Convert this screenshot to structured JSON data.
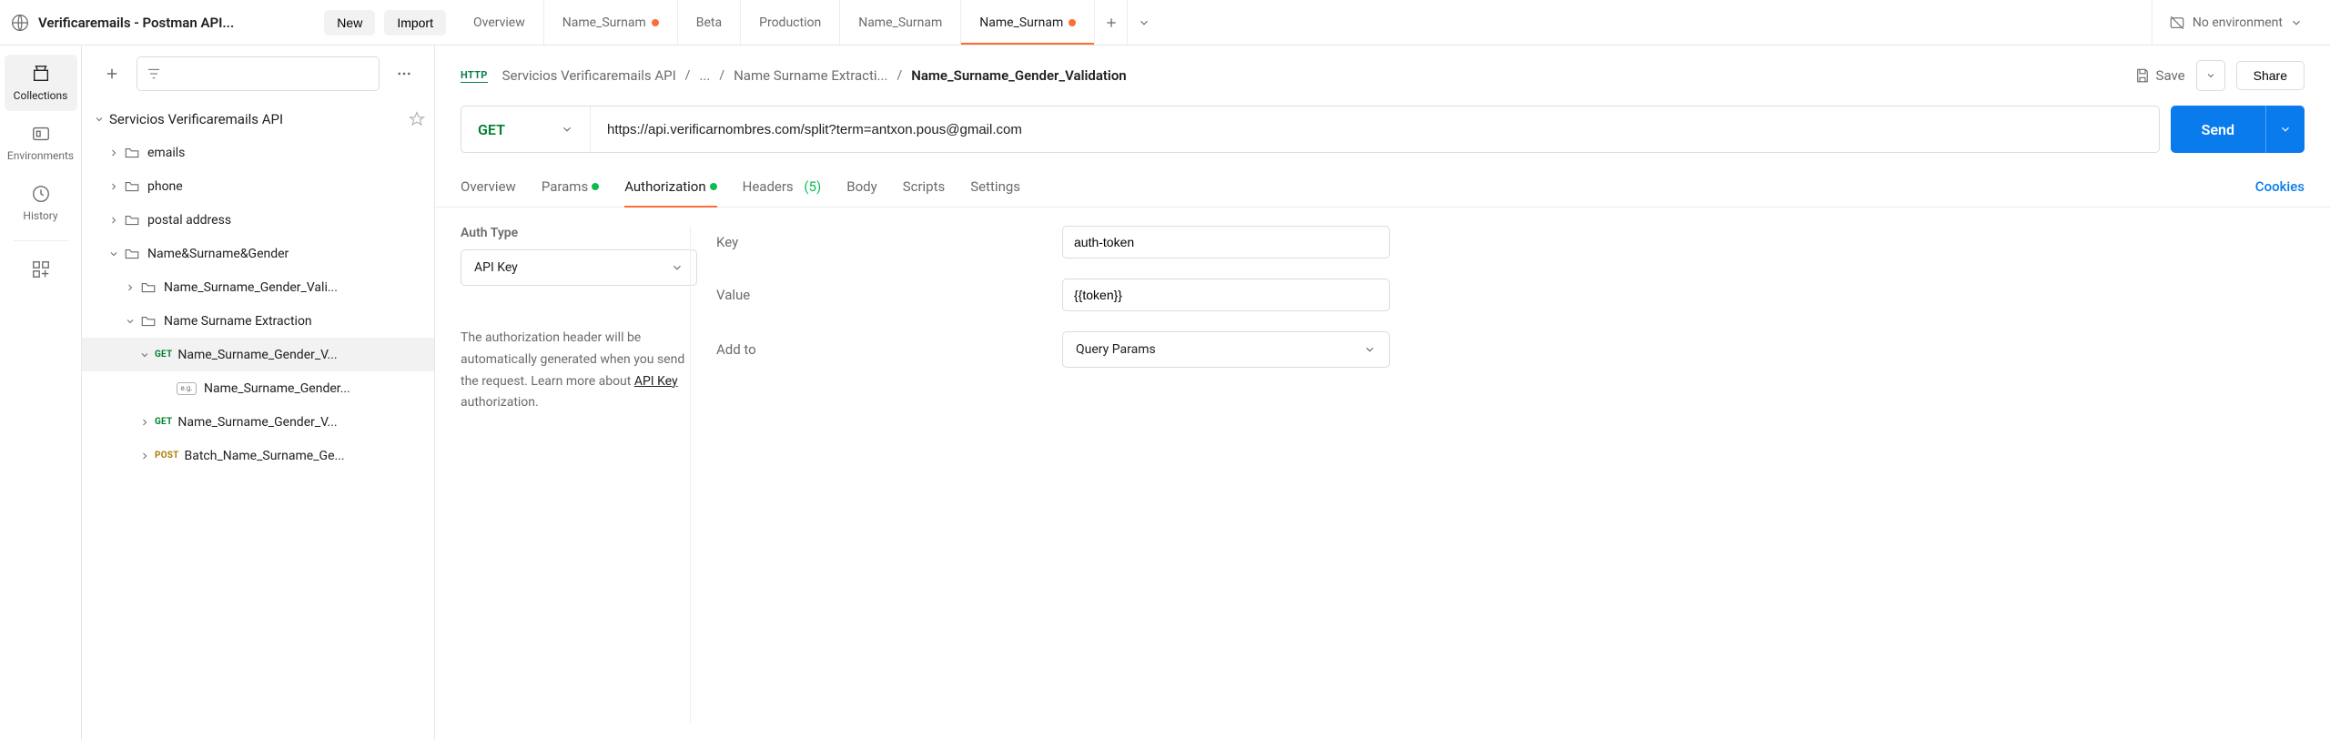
{
  "header": {
    "workspace": "Verificaremails - Postman API...",
    "new_btn": "New",
    "import_btn": "Import"
  },
  "tabs": [
    {
      "label": "Overview",
      "modified": false,
      "active": false
    },
    {
      "label": "Name_Surnam",
      "modified": true,
      "active": false
    },
    {
      "label": "Beta",
      "modified": false,
      "active": false
    },
    {
      "label": "Production",
      "modified": false,
      "active": false
    },
    {
      "label": "Name_Surnam",
      "modified": false,
      "active": false
    },
    {
      "label": "Name_Surnam",
      "modified": true,
      "active": true
    }
  ],
  "environment": {
    "label": "No environment"
  },
  "rail": [
    {
      "label": "Collections",
      "active": true
    },
    {
      "label": "Environments",
      "active": false
    },
    {
      "label": "History",
      "active": false
    }
  ],
  "tree": {
    "root": "Servicios Verificaremails API",
    "f_emails": "emails",
    "f_phone": "phone",
    "f_postal": "postal address",
    "f_nsg": "Name&Surname&Gender",
    "f_nsgv": "Name_Surname_Gender_Vali...",
    "f_nse": "Name Surname Extraction",
    "r_get_sel": "Name_Surname_Gender_V...",
    "r_example": "Name_Surname_Gender...",
    "r_get2": "Name_Surname_Gender_V...",
    "r_post": "Batch_Name_Surname_Ge...",
    "m_get": "GET",
    "m_post": "POST",
    "eg": "e.g."
  },
  "breadcrumb": {
    "http": "HTTP",
    "c0": "Servicios Verificaremails API",
    "c1": "...",
    "c2": "Name Surname Extracti...",
    "final": "Name_Surname_Gender_Validation",
    "save": "Save",
    "share": "Share"
  },
  "request": {
    "method": "GET",
    "url": "https://api.verificarnombres.com/split?term=antxon.pous@gmail.com",
    "send": "Send"
  },
  "subtabs": {
    "overview": "Overview",
    "params": "Params",
    "auth": "Authorization",
    "headers": "Headers",
    "headers_count": "(5)",
    "body": "Body",
    "scripts": "Scripts",
    "settings": "Settings",
    "cookies": "Cookies"
  },
  "auth": {
    "type_label": "Auth Type",
    "type_value": "API Key",
    "desc_1": "The authorization header will be automatically generated when you send the request. Learn more about ",
    "desc_link": "API Key",
    "desc_2": " authorization.",
    "key_label": "Key",
    "key_value": "auth-token",
    "value_label": "Value",
    "value_value": "{{token}}",
    "addto_label": "Add to",
    "addto_value": "Query Params"
  }
}
